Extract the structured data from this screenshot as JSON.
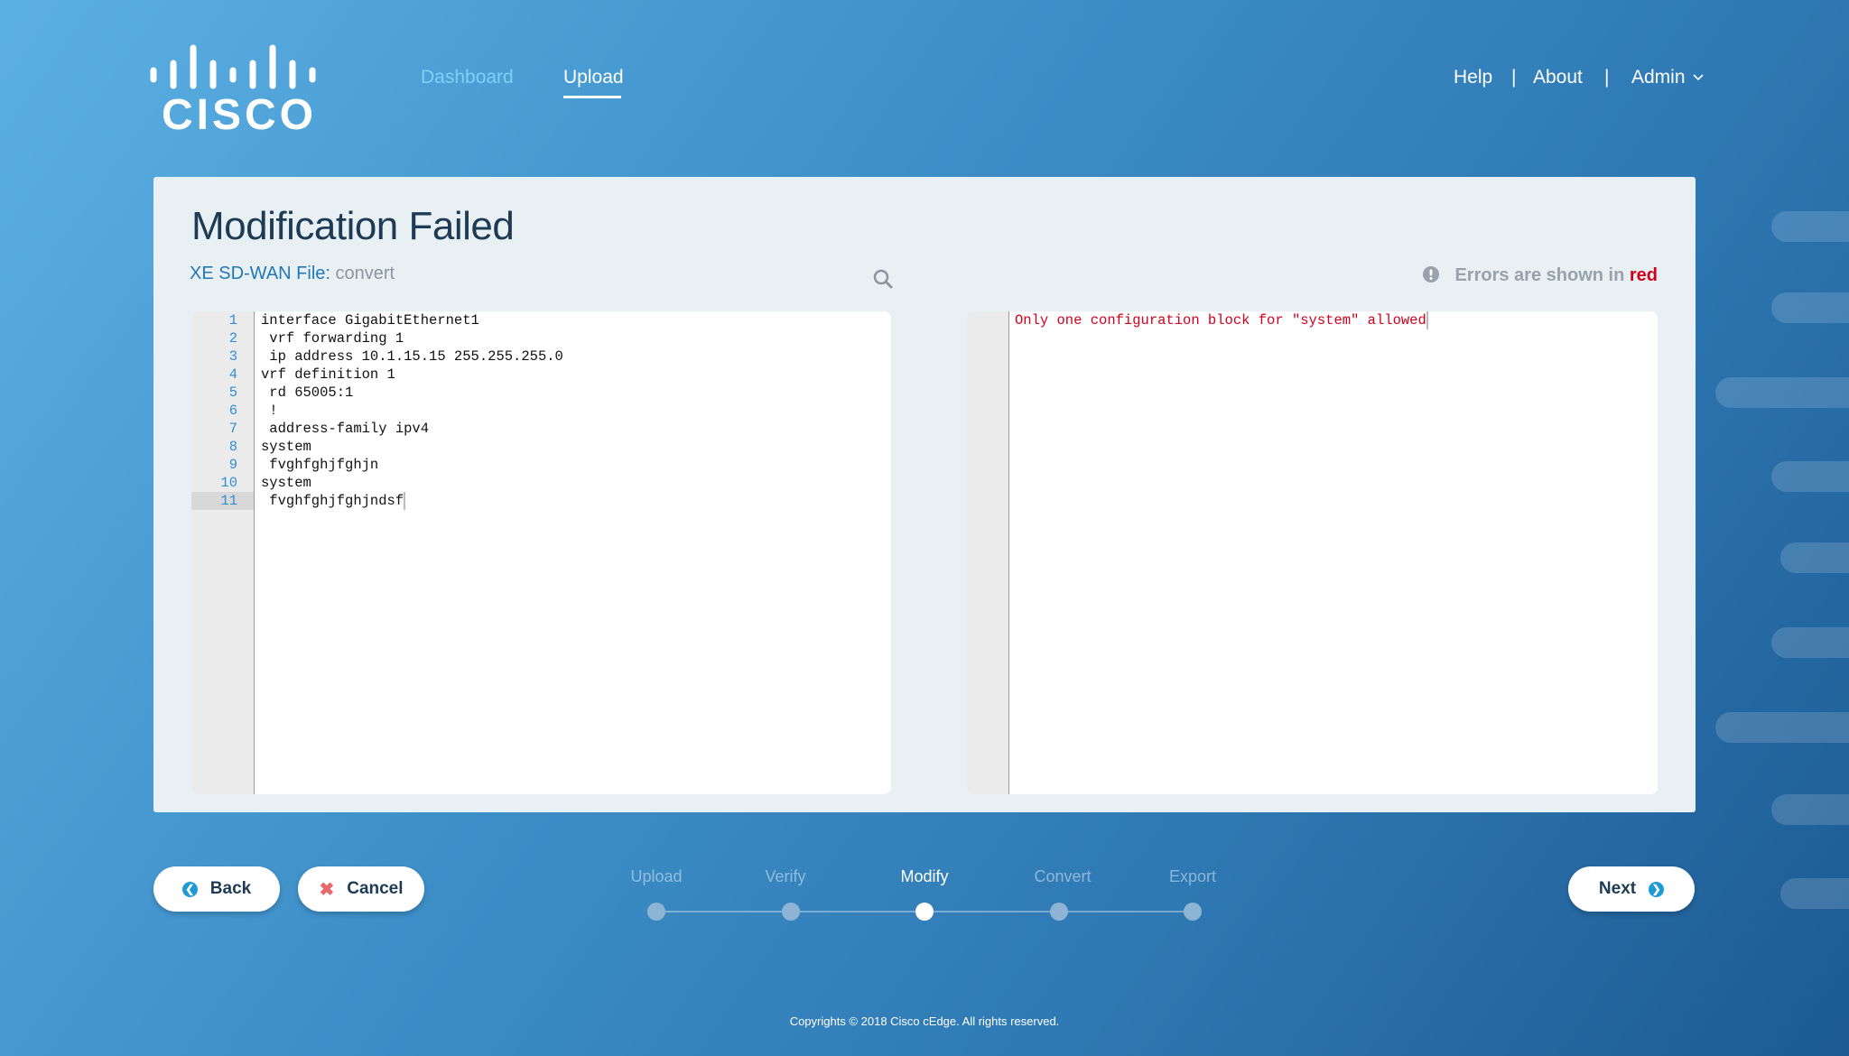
{
  "brand": {
    "logo_text": "cisco"
  },
  "nav": {
    "items": [
      {
        "label": "Dashboard",
        "active": false
      },
      {
        "label": "Upload",
        "active": true
      }
    ]
  },
  "header_right": {
    "help": "Help",
    "about": "About",
    "admin": "Admin",
    "separator": "|"
  },
  "card": {
    "title": "Modification Failed",
    "file_label": "XE SD-WAN File:",
    "file_name": "convert",
    "legend_prefix": "Errors are shown in",
    "legend_red": "red",
    "error_color": "#d0021b",
    "source_lines": [
      "interface GigabitEthernet1",
      " vrf forwarding 1",
      " ip address 10.1.15.15 255.255.255.0",
      "vrf definition 1",
      " rd 65005:1",
      " !",
      " address-family ipv4",
      "system",
      " fvghfghjfghjn",
      "system",
      " fvghfghjfghjndsf"
    ],
    "line_numbers": [
      "1",
      "2",
      "3",
      "4",
      "5",
      "6",
      "7",
      "8",
      "9",
      "10",
      "11"
    ],
    "active_line": 11,
    "errors": [
      "Only one configuration block for \"system\" allowed"
    ]
  },
  "buttons": {
    "back": "Back",
    "cancel": "Cancel",
    "next": "Next"
  },
  "stepper": {
    "steps": [
      "Upload",
      "Verify",
      "Modify",
      "Convert",
      "Export"
    ],
    "current": "Modify"
  },
  "footer": "Copyrights © 2018 Cisco cEdge. All rights reserved."
}
